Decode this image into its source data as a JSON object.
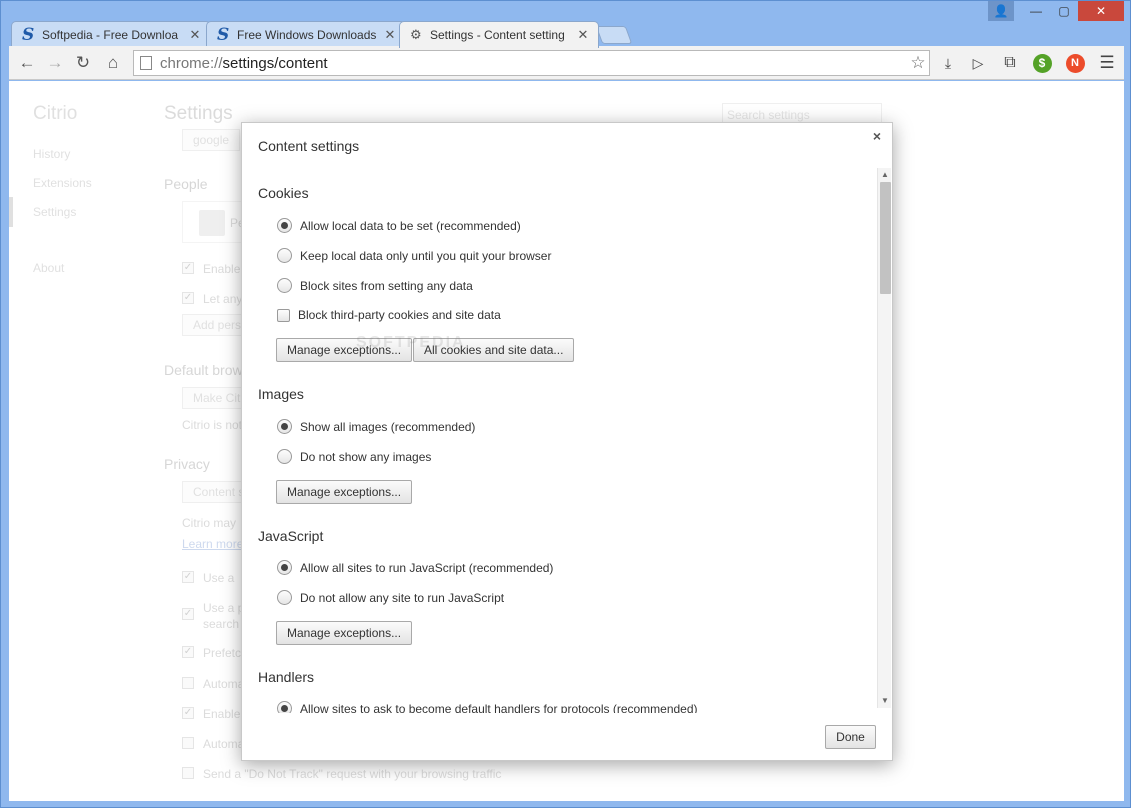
{
  "window": {
    "controls": {
      "minimize": "—",
      "maximize": "▢",
      "close": "✕"
    }
  },
  "tabs": [
    {
      "title": "Softpedia - Free Downloa",
      "favicon": "S",
      "active": false
    },
    {
      "title": "Free Windows Downloads",
      "favicon": "S",
      "active": false
    },
    {
      "title": "Settings - Content setting",
      "favicon": "⚙",
      "active": true
    }
  ],
  "toolbar": {
    "url_scheme": "chrome://",
    "url_path": "settings/content",
    "ext_green_label": "$",
    "ext_red_label": "N"
  },
  "background_page": {
    "brand": "Citrio",
    "nav": [
      "History",
      "Extensions",
      "Settings",
      "About"
    ],
    "title": "Settings",
    "search_placeholder": "Search settings",
    "search_engine": "google",
    "people_heading": "People",
    "people_name_partial": "Pe",
    "enable_partial": "Enable",
    "let_any_partial": "Let any",
    "add_person_partial": "Add pers",
    "default_browser_heading": "Default brow",
    "make_default_partial": "Make Cit",
    "citrio_is_not_partial": "Citrio is not",
    "privacy_heading": "Privacy",
    "content_settings_partial": "Content s",
    "citrio_may_partial": "Citrio may",
    "learn_more_partial": "Learn more",
    "use_a_partial": "Use a",
    "use_a_p_partial": "Use a p",
    "search_partial": "search",
    "prefetch_partial": "Prefetc",
    "autom_partial_1": "Automa",
    "enable_partial_2": "Enable",
    "autom_partial_2": "Automa",
    "do_not_track": "Send a \"Do Not Track\" request with your browsing traffic"
  },
  "dialog": {
    "title": "Content settings",
    "close_symbol": "×",
    "sections": {
      "cookies": {
        "heading": "Cookies",
        "options": [
          "Allow local data to be set (recommended)",
          "Keep local data only until you quit your browser",
          "Block sites from setting any data"
        ],
        "checkbox": "Block third-party cookies and site data",
        "btn_exceptions": "Manage exceptions...",
        "btn_all_cookies": "All cookies and site data..."
      },
      "images": {
        "heading": "Images",
        "options": [
          "Show all images (recommended)",
          "Do not show any images"
        ],
        "btn_exceptions": "Manage exceptions..."
      },
      "javascript": {
        "heading": "JavaScript",
        "options": [
          "Allow all sites to run JavaScript (recommended)",
          "Do not allow any site to run JavaScript"
        ],
        "btn_exceptions": "Manage exceptions..."
      },
      "handlers": {
        "heading": "Handlers",
        "options": [
          "Allow sites to ask to become default handlers for protocols (recommended)"
        ]
      }
    },
    "done_label": "Done"
  },
  "watermark": "SOFTPEDIA"
}
